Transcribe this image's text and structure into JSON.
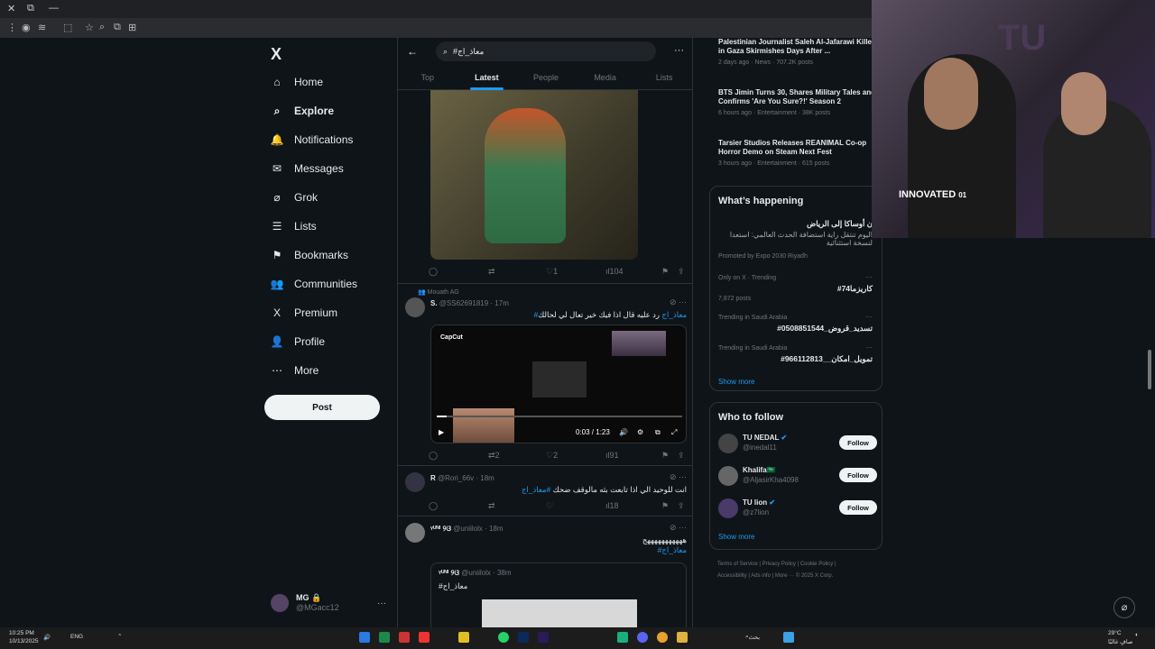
{
  "browser": {
    "window_controls": [
      "✕",
      "⧉",
      "—"
    ]
  },
  "nav": {
    "logo": "X",
    "items": [
      {
        "label": "Home",
        "icon": "⌂"
      },
      {
        "label": "Explore",
        "icon": "⌕"
      },
      {
        "label": "Notifications",
        "icon": "🔔"
      },
      {
        "label": "Messages",
        "icon": "✉"
      },
      {
        "label": "Grok",
        "icon": "⌀"
      },
      {
        "label": "Lists",
        "icon": "☰"
      },
      {
        "label": "Bookmarks",
        "icon": "⚑"
      },
      {
        "label": "Communities",
        "icon": "👥"
      },
      {
        "label": "Premium",
        "icon": "X"
      },
      {
        "label": "Profile",
        "icon": "👤"
      },
      {
        "label": "More",
        "icon": "⋯"
      }
    ],
    "post_label": "Post",
    "account": {
      "name": "MG 🔒",
      "handle": "@MGacc12"
    }
  },
  "search": {
    "query": "#معاذ_اج",
    "tabs": [
      "Top",
      "Latest",
      "People",
      "Media",
      "Lists"
    ],
    "active_tab": "Latest"
  },
  "tweets": [
    {
      "actions": {
        "reply": "",
        "repost": "",
        "likes": "1",
        "views": "104"
      }
    },
    {
      "social_context": "Mouath AG",
      "name": "S.",
      "handle": "@SS62691819",
      "time": "· 17m",
      "hashtag": "#معاذ_اج",
      "text": "رد عليه قال اذا فيك خير تعال لي لحالك",
      "video": {
        "brand": "CapCut",
        "time": "0:03 / 1:23",
        "progress": 0.04
      },
      "actions": {
        "reply": "",
        "repost": "2",
        "likes": "2",
        "views": "91"
      }
    },
    {
      "name": "R",
      "handle": "@Rori_66v",
      "time": "· 18m",
      "text": "انت للوحيد الي اذا تابعت بثه مالوقف ضحك",
      "hashtag": "#معاذ_اج",
      "actions": {
        "reply": "",
        "repost": "",
        "likes": "",
        "views": "18"
      }
    },
    {
      "name": "ᵞᵁᴺᴵ ୨ଓ",
      "handle": "@uniilolx",
      "time": "· 18m",
      "text": "هههههههههههج",
      "hashtag": "#معاذ_اج",
      "quote": {
        "name": "ᵞᵁᴺᴵ ୨ଓ",
        "handle": "@uniilolx",
        "time": "· 38m",
        "text": "#معاذ_اج"
      }
    }
  ],
  "news": [
    {
      "title": "Palestinian Journalist Saleh Al-Jafarawi Killed in Gaza Skirmishes Days After ...",
      "meta": "2 days ago · News · 707.2K posts"
    },
    {
      "title": "BTS Jimin Turns 30, Shares Military Tales and Confirms 'Are You Sure?!' Season 2",
      "meta": "6 hours ago · Entertainment · 38K posts"
    },
    {
      "title": "Tarsier Studios Releases REANIMAL Co-op Horror Demo on Steam Next Fest",
      "meta": "3 hours ago · Entertainment · 615 posts"
    }
  ],
  "happening": {
    "title": "What’s happening",
    "promo": {
      "title": "ن أوساكا إلى الرياض",
      "text": "اليوم تنتقل راية استضافة الحدث العالمي: استعدا لنسخة استثنائية",
      "by": "Promoted by Expo 2030 Riyadh"
    },
    "trends": [
      {
        "context": "Only on X · Trending",
        "name": "#كاريزما74",
        "posts": "7,872 posts"
      },
      {
        "context": "Trending in Saudi Arabia",
        "name": "#تسديد_قروض_0508851544"
      },
      {
        "context": "Trending in Saudi Arabia",
        "name": "#تمويل_امكان__966112813"
      }
    ],
    "show_more": "Show more"
  },
  "who_to_follow": {
    "title": "Who to follow",
    "users": [
      {
        "name": "TU NEDAL",
        "handle": "@inedal11",
        "button": "Follow"
      },
      {
        "name": "Khalifa🇸🇦",
        "handle": "@AljasirKha4098",
        "button": "Follow"
      },
      {
        "name": "TU lion",
        "handle": "@z7lion",
        "button": "Follow"
      }
    ],
    "show_more": "Show more"
  },
  "footer": {
    "links": [
      "Terms of Service",
      "Privacy Policy",
      "Cookie Policy",
      "Accessibility",
      "Ads info",
      "More ···",
      "© 2025 X Corp."
    ]
  },
  "webcam": {
    "shirt_text": "INNOVATED",
    "shirt_num": "01"
  },
  "taskbar": {
    "time": "10:25 PM",
    "date": "10/13/2025",
    "lang": "ENG",
    "search_label": "بحث",
    "weather": "29°C",
    "weather_desc": "صافٍ غالبًا"
  },
  "colors": {
    "accent": "#1d9bf0",
    "bg": "#0f1419",
    "border": "#2f3336",
    "muted": "#71767b"
  }
}
